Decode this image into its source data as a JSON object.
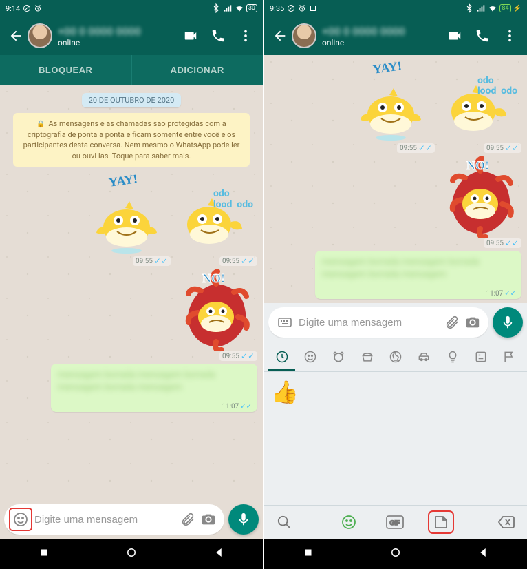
{
  "left": {
    "status": {
      "time": "9:14",
      "battery": "30"
    },
    "header": {
      "name": "+00 0 0000 0000",
      "status": "online"
    },
    "actions": {
      "block": "BLOQUEAR",
      "add": "ADICIONAR"
    },
    "date_chip": "20 DE OUTUBRO DE 2020",
    "encryption": "As mensagens e as chamadas são protegidas com a criptografia de ponta a ponta e ficam somente entre você e os participantes desta conversa. Nem mesmo o WhatsApp pode ler ou ouvi-las. Toque para saber mais.",
    "stickers": {
      "yay": "YAY!",
      "dodo": "odo\nlood  odo",
      "no": "NO!",
      "time_a": "09:55",
      "time_b": "09:55",
      "time_c": "09:55"
    },
    "bubble": {
      "text": "mensagem borrada mensagem borrada mensagem borrada mensagem",
      "time": "11:07"
    },
    "input": {
      "placeholder": "Digite uma mensagem"
    }
  },
  "right": {
    "status": {
      "time": "9:35",
      "battery": "84"
    },
    "header": {
      "name": "+00 0 0000 0000",
      "status": "online"
    },
    "stickers": {
      "yay": "YAY!",
      "dodo": "odo\nlood  odo",
      "no": "NO!",
      "time_a": "09:55",
      "time_b": "09:55",
      "time_c": "09:55"
    },
    "bubble": {
      "text": "mensagem borrada mensagem borrada mensagem borrada mensagem",
      "time": "11:07"
    },
    "input": {
      "placeholder": "Digite uma mensagem"
    },
    "emoji_panel": {
      "thumbs": "👍"
    }
  }
}
